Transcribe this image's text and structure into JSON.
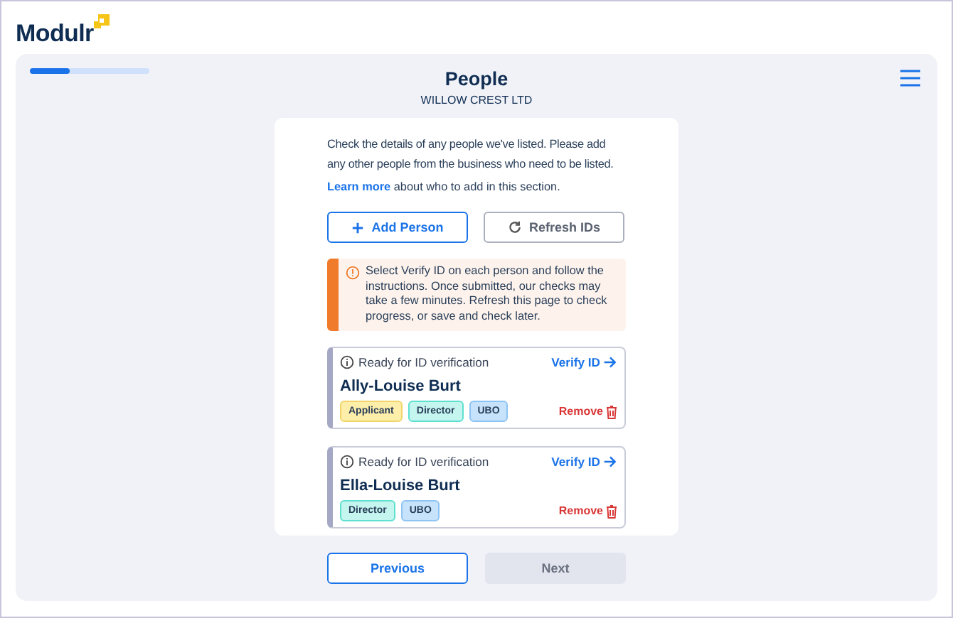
{
  "logo": {
    "text": "Modulr"
  },
  "progress": {
    "level": 0.33
  },
  "header": {
    "title": "People",
    "subtitle": "WILLOW CREST LTD"
  },
  "intro": {
    "text": "Check the details of any people we've listed. Please add any other people from the business who need to be listed.",
    "link": "Learn more",
    "link_suffix": " about who to add in this section."
  },
  "actions": [
    {
      "kind": "add",
      "label": "Add Person"
    },
    {
      "kind": "refresh",
      "label": "Refresh IDs"
    }
  ],
  "notice": {
    "text": "Select Verify ID on each person and follow the instructions. Once submitted, our checks may take a few minutes. Refresh this page to check progress, or save and check later."
  },
  "people": [
    {
      "status": "Ready for ID verification",
      "action": "Verify ID",
      "name": "Ally-Louise Burt",
      "remove": "Remove",
      "tags": [
        {
          "label": "Applicant",
          "color": "#fdeeaa"
        },
        {
          "label": "Director",
          "color": "#c4f5ef"
        },
        {
          "label": "UBO",
          "color": "#c7e3fb"
        }
      ]
    },
    {
      "status": "Ready for ID verification",
      "action": "Verify ID",
      "name": "Ella-Louise Burt",
      "remove": "Remove",
      "tags": [
        {
          "label": "Director",
          "color": "#c4f5ef"
        },
        {
          "label": "UBO",
          "color": "#c7e3fb"
        }
      ]
    }
  ],
  "footer": [
    {
      "label": "Previous",
      "disabled": false
    },
    {
      "label": "Next",
      "disabled": true
    }
  ]
}
